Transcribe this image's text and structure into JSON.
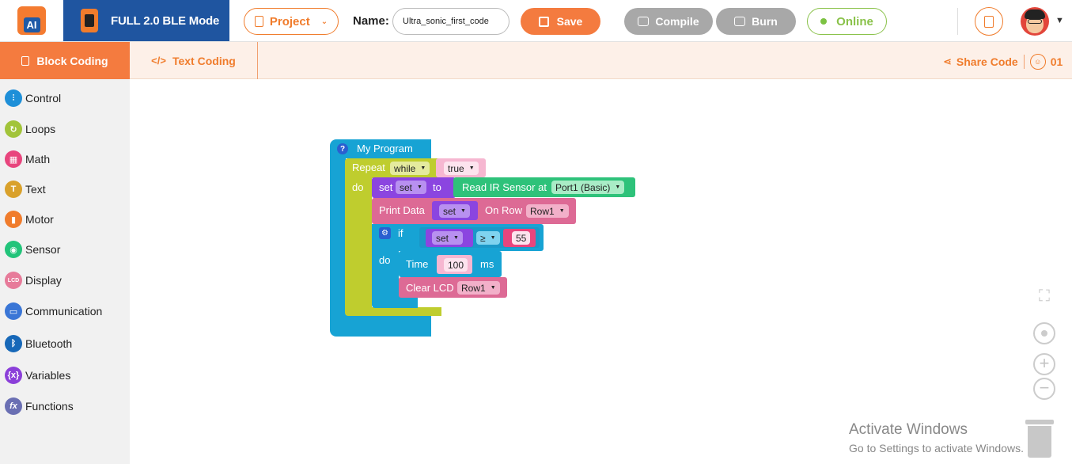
{
  "topbar": {
    "logo_text": "AI",
    "mode_label": "FULL 2.0 BLE Mode",
    "project_label": "Project",
    "name_label": "Name:",
    "name_value": "Ultra_sonic_first_code",
    "save_label": "Save",
    "compile_label": "Compile",
    "burn_label": "Burn",
    "online_label": "Online"
  },
  "tabs": {
    "block_coding": "Block Coding",
    "text_coding": "Text Coding",
    "share_code": "Share Code",
    "counter": "01"
  },
  "categories": [
    {
      "label": "Control",
      "icon": "sliders-icon",
      "color": "#1e8fd8"
    },
    {
      "label": "Loops",
      "icon": "loop-icon",
      "color": "#a2c43a"
    },
    {
      "label": "Math",
      "icon": "calculator-icon",
      "color": "#e8457d"
    },
    {
      "label": "Text",
      "icon": "text-icon",
      "color": "#d9a12b"
    },
    {
      "label": "Motor",
      "icon": "motor-icon",
      "color": "#f07c2c"
    },
    {
      "label": "Sensor",
      "icon": "sensor-icon",
      "color": "#22c47a"
    },
    {
      "label": "Display",
      "icon": "lcd-icon",
      "color": "#e77b9a"
    },
    {
      "label": "Communication",
      "icon": "chat-icon",
      "color": "#3a76d6"
    },
    {
      "label": "Bluetooth",
      "icon": "bluetooth-icon",
      "color": "#1768b8"
    },
    {
      "label": "Variables",
      "icon": "variable-icon",
      "color": "#8b3fd9"
    },
    {
      "label": "Functions",
      "icon": "function-icon",
      "color": "#6a6fb3"
    }
  ],
  "blocks": {
    "program_title": "My Program",
    "repeat": "Repeat",
    "repeat_mode": "while",
    "repeat_cond": "true",
    "do": "do",
    "set_kw": "set",
    "set_var": "set",
    "to_kw": "to",
    "read_ir": "Read IR Sensor at",
    "port": "Port1 (Basic)",
    "print_data": "Print Data",
    "print_var": "set",
    "on_row": "On Row",
    "row1": "Row1",
    "if_kw": "if",
    "if_var": "set",
    "compare_op": "≥",
    "compare_val": "55",
    "do2": "do",
    "time_kw": "Time",
    "time_val": "100",
    "ms": "ms",
    "clear_lcd": "Clear LCD",
    "clear_row": "Row1"
  },
  "watermark": {
    "title": "Activate Windows",
    "subtitle": "Go to Settings to activate Windows."
  },
  "colors": {
    "accent": "#f47b3f",
    "brand_blue": "#1f55a0",
    "control_blue": "#1aa3d4",
    "loop_green": "#bfcd2e",
    "variable_purple": "#8b45e0",
    "sensor_green": "#2ec27a",
    "display_pink": "#dd6a95",
    "math_pink": "#f3a0c2"
  }
}
